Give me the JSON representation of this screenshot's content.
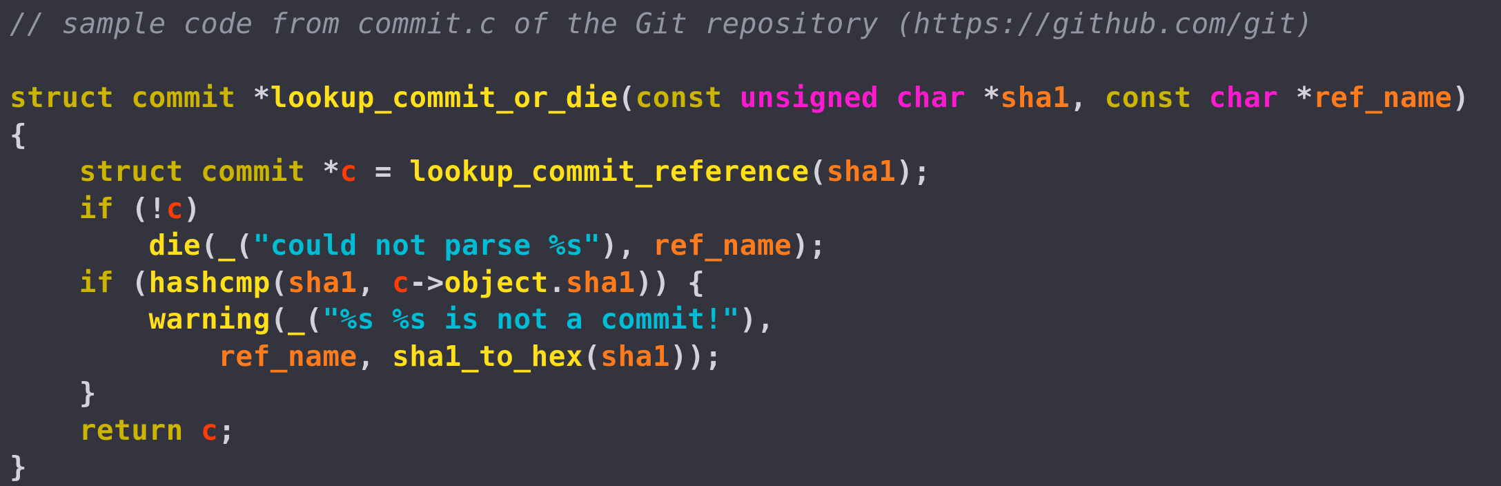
{
  "editor": {
    "background_color": "#34343f",
    "font": "monospace",
    "language": "c"
  },
  "palette": {
    "comment": "#9395a3",
    "keyword": "#cbb500",
    "function": "#ffe01a",
    "punctuation": "#d2d2da",
    "type": "#ff1ad1",
    "variable": "#ff7b1c",
    "variable_alt": "#ff3b07",
    "string": "#00bcd4"
  },
  "code": {
    "plain_text": "// sample code from commit.c of the Git repository (https://github.com/git)\n\nstruct commit *lookup_commit_or_die(const unsigned char *sha1, const char *ref_name)\n{\n    struct commit *c = lookup_commit_reference(sha1);\n    if (!c)\n        die(_(\"could not parse %s\"), ref_name);\n    if (hashcmp(sha1, c->object.sha1)) {\n        warning(_(\"%s %s is not a commit!\"),\n            ref_name, sha1_to_hex(sha1));\n    }\n    return c;\n}",
    "lines": [
      {
        "index": 1,
        "tokens": [
          {
            "text": "// sample code from commit.c of the Git repository (https://github.com/git)",
            "kind": "comment"
          }
        ]
      },
      {
        "index": 2,
        "tokens": []
      },
      {
        "index": 3,
        "tokens": [
          {
            "text": "struct commit ",
            "kind": "keyword"
          },
          {
            "text": "*",
            "kind": "punct"
          },
          {
            "text": "lookup_commit_or_die",
            "kind": "func"
          },
          {
            "text": "(",
            "kind": "punct"
          },
          {
            "text": "const ",
            "kind": "keyword"
          },
          {
            "text": "unsigned char ",
            "kind": "type"
          },
          {
            "text": "*",
            "kind": "punct"
          },
          {
            "text": "sha1",
            "kind": "var"
          },
          {
            "text": ", ",
            "kind": "punct"
          },
          {
            "text": "const ",
            "kind": "keyword"
          },
          {
            "text": "char ",
            "kind": "type"
          },
          {
            "text": "*",
            "kind": "punct"
          },
          {
            "text": "ref_name",
            "kind": "var"
          },
          {
            "text": ")",
            "kind": "punct"
          }
        ]
      },
      {
        "index": 4,
        "tokens": [
          {
            "text": "{",
            "kind": "punct"
          }
        ]
      },
      {
        "index": 5,
        "tokens": [
          {
            "text": "    ",
            "kind": "punct"
          },
          {
            "text": "struct commit ",
            "kind": "keyword"
          },
          {
            "text": "*",
            "kind": "punct"
          },
          {
            "text": "c",
            "kind": "var2"
          },
          {
            "text": " = ",
            "kind": "punct"
          },
          {
            "text": "lookup_commit_reference",
            "kind": "func"
          },
          {
            "text": "(",
            "kind": "punct"
          },
          {
            "text": "sha1",
            "kind": "var"
          },
          {
            "text": ");",
            "kind": "punct"
          }
        ]
      },
      {
        "index": 6,
        "tokens": [
          {
            "text": "    ",
            "kind": "punct"
          },
          {
            "text": "if",
            "kind": "keyword"
          },
          {
            "text": " (!",
            "kind": "punct"
          },
          {
            "text": "c",
            "kind": "var2"
          },
          {
            "text": ")",
            "kind": "punct"
          }
        ]
      },
      {
        "index": 7,
        "tokens": [
          {
            "text": "        ",
            "kind": "punct"
          },
          {
            "text": "die",
            "kind": "func"
          },
          {
            "text": "(",
            "kind": "punct"
          },
          {
            "text": "_",
            "kind": "func"
          },
          {
            "text": "(",
            "kind": "punct"
          },
          {
            "text": "\"could not parse %s\"",
            "kind": "string"
          },
          {
            "text": "), ",
            "kind": "punct"
          },
          {
            "text": "ref_name",
            "kind": "var"
          },
          {
            "text": ");",
            "kind": "punct"
          }
        ]
      },
      {
        "index": 8,
        "tokens": [
          {
            "text": "    ",
            "kind": "punct"
          },
          {
            "text": "if",
            "kind": "keyword"
          },
          {
            "text": " (",
            "kind": "punct"
          },
          {
            "text": "hashcmp",
            "kind": "func"
          },
          {
            "text": "(",
            "kind": "punct"
          },
          {
            "text": "sha1",
            "kind": "var"
          },
          {
            "text": ", ",
            "kind": "punct"
          },
          {
            "text": "c",
            "kind": "var2"
          },
          {
            "text": "->",
            "kind": "punct"
          },
          {
            "text": "object",
            "kind": "func"
          },
          {
            "text": ".",
            "kind": "punct"
          },
          {
            "text": "sha1",
            "kind": "var"
          },
          {
            "text": ")) {",
            "kind": "punct"
          }
        ]
      },
      {
        "index": 9,
        "tokens": [
          {
            "text": "        ",
            "kind": "punct"
          },
          {
            "text": "warning",
            "kind": "func"
          },
          {
            "text": "(",
            "kind": "punct"
          },
          {
            "text": "_",
            "kind": "func"
          },
          {
            "text": "(",
            "kind": "punct"
          },
          {
            "text": "\"%s %s is not a commit!\"",
            "kind": "string"
          },
          {
            "text": "),",
            "kind": "punct"
          }
        ]
      },
      {
        "index": 10,
        "tokens": [
          {
            "text": "            ",
            "kind": "punct"
          },
          {
            "text": "ref_name",
            "kind": "var"
          },
          {
            "text": ", ",
            "kind": "punct"
          },
          {
            "text": "sha1_to_hex",
            "kind": "func"
          },
          {
            "text": "(",
            "kind": "punct"
          },
          {
            "text": "sha1",
            "kind": "var"
          },
          {
            "text": "));",
            "kind": "punct"
          }
        ]
      },
      {
        "index": 11,
        "tokens": [
          {
            "text": "    }",
            "kind": "punct"
          }
        ]
      },
      {
        "index": 12,
        "tokens": [
          {
            "text": "    ",
            "kind": "punct"
          },
          {
            "text": "return",
            "kind": "keyword"
          },
          {
            "text": " ",
            "kind": "punct"
          },
          {
            "text": "c",
            "kind": "var2"
          },
          {
            "text": ";",
            "kind": "punct"
          }
        ]
      },
      {
        "index": 13,
        "tokens": [
          {
            "text": "}",
            "kind": "punct"
          }
        ]
      }
    ]
  }
}
